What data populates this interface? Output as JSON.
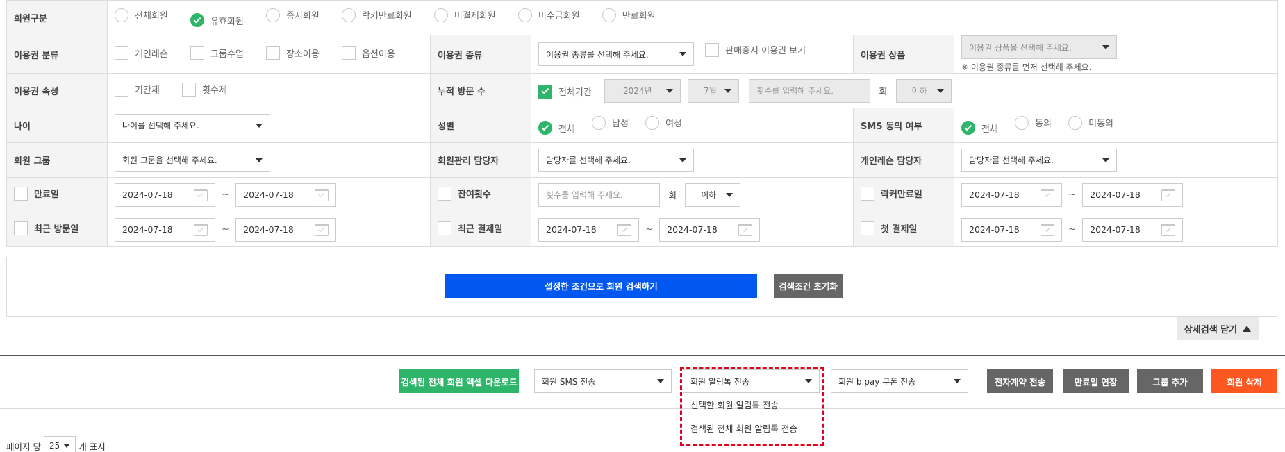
{
  "member_type": {
    "label": "회원구분",
    "options": [
      "전체회원",
      "유효회원",
      "중지회원",
      "락커만료회원",
      "미결제회원",
      "미수금회원",
      "만료회원"
    ],
    "selected_index": 1
  },
  "pass_category": {
    "label": "이용권 분류",
    "options": [
      "개인레슨",
      "그룹수업",
      "장소이용",
      "옵션이용"
    ]
  },
  "pass_type": {
    "label": "이용권 종류",
    "placeholder": "이용권 종류를 선택해 주세요.",
    "stop_sale_label": "판매중지 이용권 보기"
  },
  "pass_product": {
    "label": "이용권 상품",
    "placeholder": "이용권 상품을 선택해 주세요.",
    "note": "※ 이용권 종류를 먼저 선택해 주세요."
  },
  "pass_attr": {
    "label": "이용권 속성",
    "options": [
      "기간제",
      "횟수제"
    ]
  },
  "visits": {
    "label": "누적 방문 수",
    "all_period_label": "전체기간",
    "year": "2024년",
    "month": "7월",
    "count_placeholder": "횟수를 입력해 주세요.",
    "unit": "회",
    "compare": "이하"
  },
  "age": {
    "label": "나이",
    "placeholder": "나이를 선택해 주세요."
  },
  "gender": {
    "label": "성별",
    "options": [
      "전체",
      "남성",
      "여성"
    ],
    "selected_index": 0
  },
  "sms_consent": {
    "label": "SMS 동의 여부",
    "options": [
      "전체",
      "동의",
      "미동의"
    ],
    "selected_index": 0
  },
  "member_group": {
    "label": "회원 그룹",
    "placeholder": "회원 그룹을 선택해 주세요."
  },
  "manager": {
    "label": "회원관리 담당자",
    "placeholder": "담당자를 선택해 주세요."
  },
  "lesson_manager": {
    "label": "개인레슨 담당자",
    "placeholder": "담당자를 선택해 주세요."
  },
  "expiry": {
    "label": "만료일",
    "from": "2024-07-18",
    "to": "2024-07-18"
  },
  "remaining": {
    "label": "잔여횟수",
    "placeholder": "횟수를 입력해 주세요.",
    "unit": "회",
    "compare": "이하"
  },
  "locker_expiry": {
    "label": "락커만료일",
    "from": "2024-07-18",
    "to": "2024-07-18"
  },
  "last_visit": {
    "label": "최근 방문일",
    "from": "2024-07-18",
    "to": "2024-07-18"
  },
  "last_payment": {
    "label": "최근 결제일",
    "from": "2024-07-18",
    "to": "2024-07-18"
  },
  "first_payment": {
    "label": "첫 결제일",
    "from": "2024-07-18",
    "to": "2024-07-18"
  },
  "tilde": "~",
  "search_button": "설정한 조건으로 회원 검색하기",
  "reset_button": "검색조건 초기화",
  "detail_toggle": "상세검색 닫기",
  "actions": {
    "excel": "검색된 전체 회원 엑셀 다운로드",
    "sms": "회원 SMS 전송",
    "alimtalk": "회원 알림톡 전송",
    "bpay": "회원 b.pay 쿠폰 전송",
    "contract": "전자계약 전송",
    "extend": "만료일 연장",
    "add_group": "그룹 추가",
    "delete": "회원 삭제",
    "pipe": "|"
  },
  "alimtalk_menu": [
    "선택한 회원 알림톡 전송",
    "검색된 전체 회원 알림톡 전송"
  ],
  "pager": {
    "prefix": "페이지 당",
    "value": "25",
    "suffix": "개 표시"
  },
  "colors": {
    "green": "#2fb56a",
    "blue": "#0058f0",
    "gray": "#666666",
    "orange": "#ff5722",
    "red_dash": "#e3001b"
  }
}
